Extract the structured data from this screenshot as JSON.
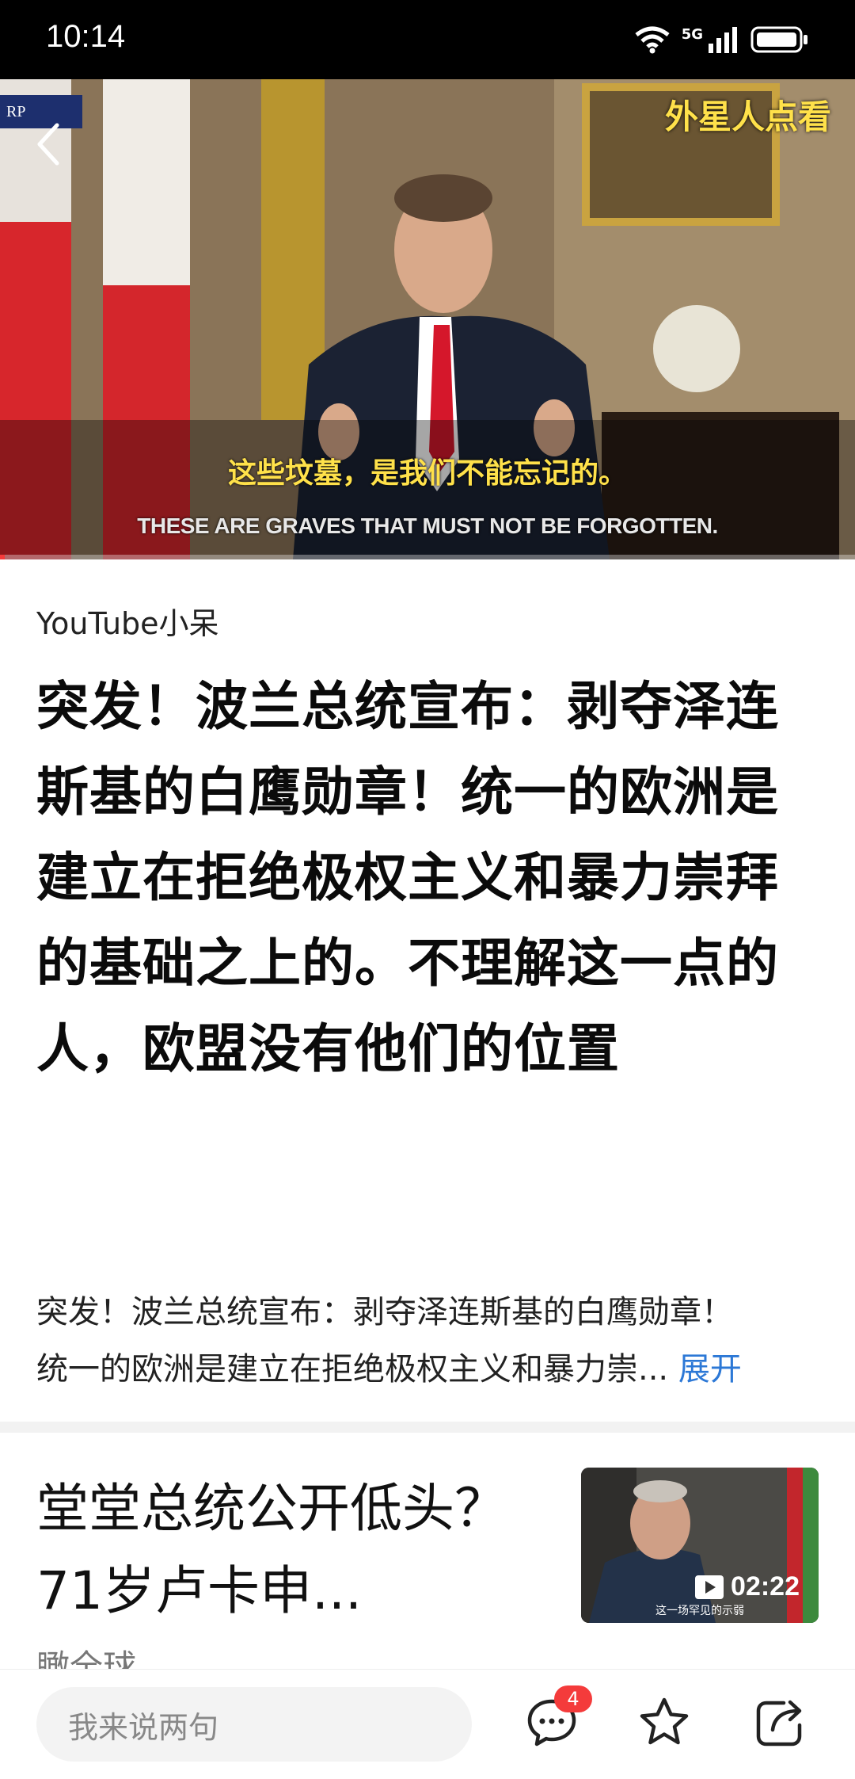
{
  "status_bar": {
    "time": "10:14",
    "network": "5G"
  },
  "video": {
    "watermark": "外星人点看",
    "logo": "RP",
    "subtitle_cn": "这些坟墓，是我们不能忘记的。",
    "subtitle_en": "THESE ARE GRAVES THAT MUST NOT BE FORGOTTEN.",
    "progress": 0.005
  },
  "article": {
    "author": "YouTube小呆",
    "headline": "突发！波兰总统宣布：剥夺泽连斯基的白鹰勋章！统一的欧洲是建立在拒绝极权主义和暴力崇拜的基础之上的。不理解这一点的人，欧盟没有他们的位置",
    "summary_line1": "突发！波兰总统宣布：剥夺泽连斯基的白鹰勋章！",
    "summary_line2": "统一的欧洲是建立在拒绝极权主义和暴力崇...",
    "expand_label": "展开"
  },
  "recommendation": {
    "title": "堂堂总统公开低头？71岁卢卡申...",
    "source": "瞰全球",
    "duration": "02:22",
    "thumb_caption": "这一场罕见的示弱"
  },
  "bottom_bar": {
    "comment_placeholder": "我来说两句",
    "comment_count": "4"
  },
  "colors": {
    "accent": "#2c78d6",
    "badge": "#f43b3b",
    "subtitle": "#ffe14a"
  }
}
